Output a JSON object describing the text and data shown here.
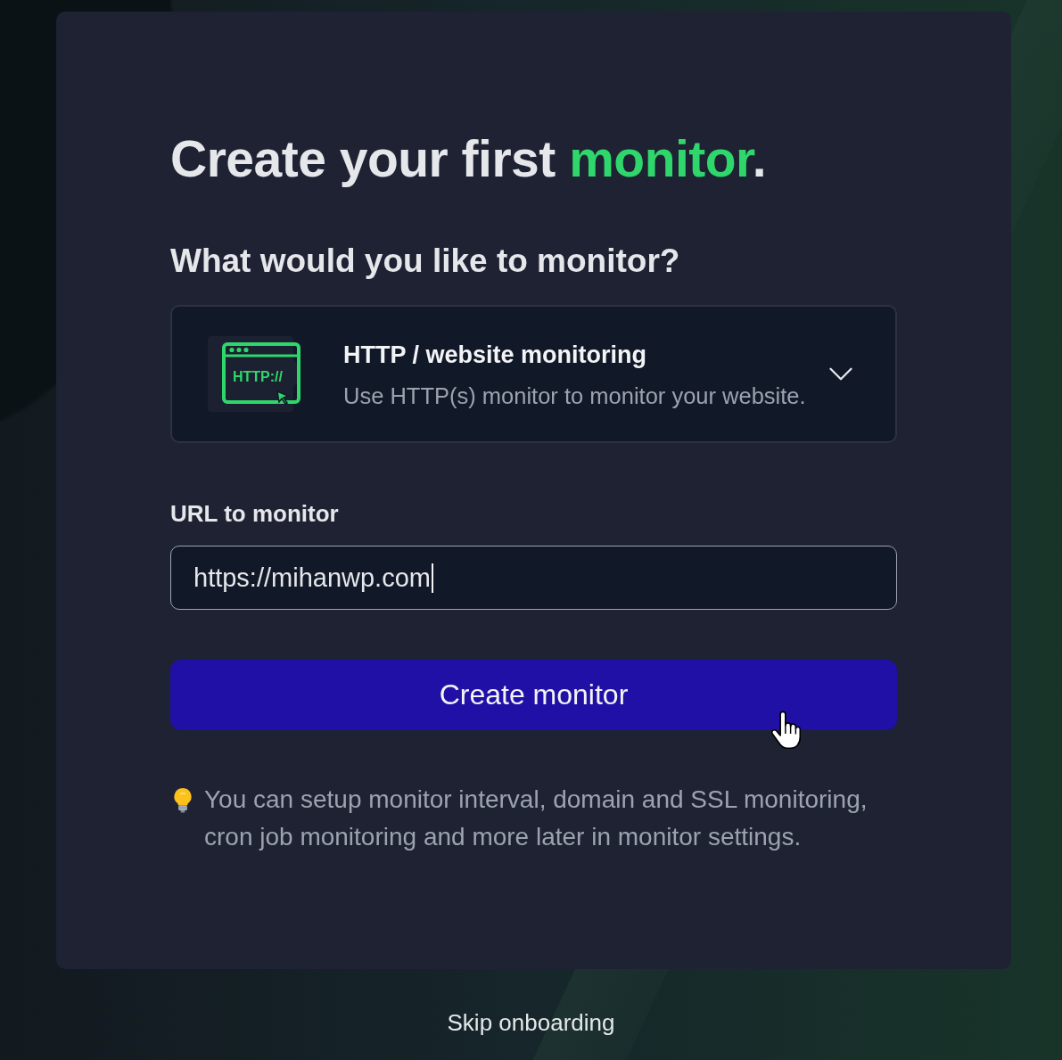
{
  "heading": {
    "text": "Create your first",
    "highlight": "monitor",
    "end": "."
  },
  "question": "What would you like to monitor?",
  "monitor_type": {
    "badge": "HTTP://",
    "title": "HTTP / website monitoring",
    "description": "Use HTTP(s) monitor to monitor your website.",
    "expanded": false
  },
  "url_field": {
    "label": "URL to monitor",
    "value": "https://mihanwp.com",
    "focused": true
  },
  "submit_button": "Create monitor",
  "tip": "You can setup monitor interval, domain and SSL monitoring, cron job monitoring and more later in monitor settings.",
  "skip_link": "Skip onboarding"
}
